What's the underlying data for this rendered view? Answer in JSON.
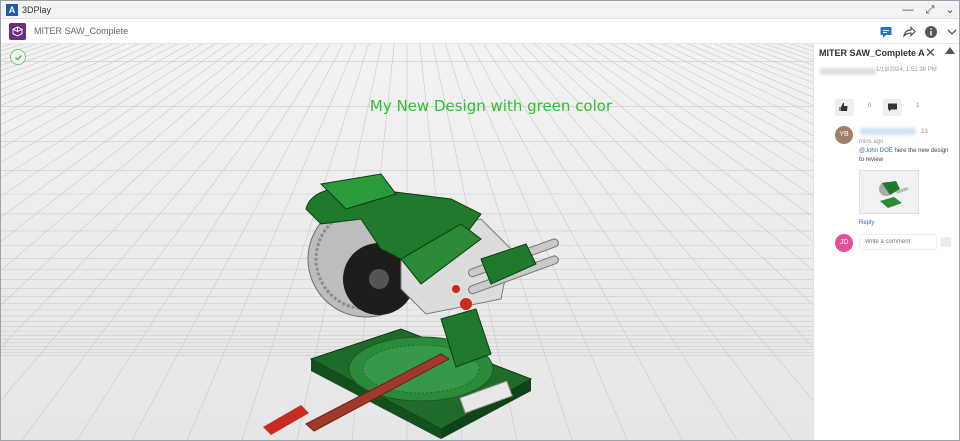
{
  "app": {
    "title": "3DPlay",
    "logo_letter": "A"
  },
  "window_controls": {
    "minimize": "—",
    "maximize": "⤢",
    "menu": "⌄"
  },
  "toolbar": {
    "document_title": "MITER SAW_Complete"
  },
  "viewport": {
    "annotation": "My New Design with green color"
  },
  "panel": {
    "title": "MITER SAW_Complete A",
    "date": "1/19/2024, 1:51:38 PM",
    "likes": "0",
    "comments": "1",
    "comment": {
      "avatar_initials": "YB",
      "time": "23 mins ago",
      "mention": "@John DOE",
      "text": " here the new design to review",
      "reply_label": "Reply"
    },
    "new_comment": {
      "avatar_initials": "JD",
      "placeholder": "Write a comment"
    }
  },
  "colors": {
    "accent_green": "#2fbf2f",
    "brand_purple": "#6b2d82",
    "link_blue": "#2a6ebb",
    "avatar_yb": "#a07e6a",
    "avatar_jd": "#e24f9a"
  },
  "icons": [
    "check-icon",
    "comment-icon",
    "share-icon",
    "info-icon",
    "chevron-down-icon",
    "close-icon",
    "collapse-icon",
    "thumbs-up-icon",
    "send-icon"
  ]
}
